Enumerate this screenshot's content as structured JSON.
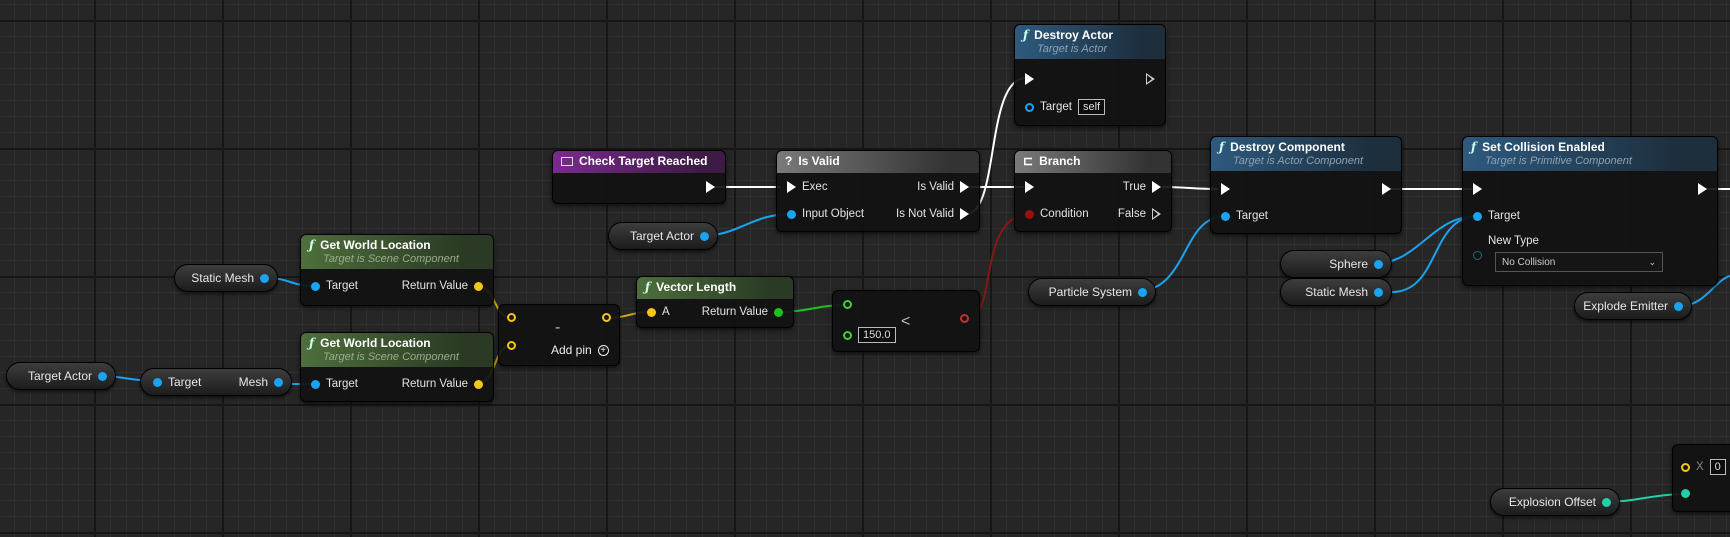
{
  "nodes": {
    "destroy_actor": {
      "title": "Destroy Actor",
      "subtitle": "Target is Actor",
      "target_label": "Target",
      "target_value": "self"
    },
    "check_target": {
      "title": "Check Target Reached"
    },
    "is_valid": {
      "title": "Is Valid",
      "exec_label": "Exec",
      "input_label": "Input Object",
      "out_valid": "Is Valid",
      "out_not_valid": "Is Not Valid"
    },
    "branch": {
      "title": "Branch",
      "condition_label": "Condition",
      "true_label": "True",
      "false_label": "False"
    },
    "destroy_component": {
      "title": "Destroy Component",
      "subtitle": "Target is Actor Component",
      "target_label": "Target"
    },
    "set_collision": {
      "title": "Set Collision Enabled",
      "subtitle": "Target is Primitive Component",
      "target_label": "Target",
      "new_type_label": "New Type",
      "new_type_value": "No Collision"
    },
    "get_world_location_1": {
      "title": "Get World Location",
      "subtitle": "Target is Scene Component",
      "target_label": "Target",
      "return_label": "Return Value"
    },
    "get_world_location_2": {
      "title": "Get World Location",
      "subtitle": "Target is Scene Component",
      "target_label": "Target",
      "return_label": "Return Value"
    },
    "subtract": {
      "symbol": "-",
      "add_pin_label": "Add pin"
    },
    "vector_length": {
      "title": "Vector Length",
      "a_label": "A",
      "return_label": "Return Value"
    },
    "less_than": {
      "symbol": "<",
      "b_value": "150.0"
    },
    "mesh_getter": {
      "target_label": "Target",
      "mesh_label": "Mesh"
    },
    "make_vector": {
      "x_label": "X",
      "x_value": "0"
    }
  },
  "variables": {
    "target_actor_1": "Target Actor",
    "target_actor_2": "Target Actor",
    "static_mesh_1": "Static Mesh",
    "static_mesh_2": "Static Mesh",
    "particle_system": "Particle System",
    "sphere": "Sphere",
    "explode_emitter": "Explode Emitter",
    "explosion_offset": "Explosion Offset"
  },
  "colors": {
    "exec_wire": "#ffffff",
    "object_pin": "#1aa4f0",
    "vector_pin": "#f5c518",
    "float_pin": "#1ec21e",
    "bool_pin": "#9a1010",
    "teal_pin": "#1fd0a8"
  }
}
